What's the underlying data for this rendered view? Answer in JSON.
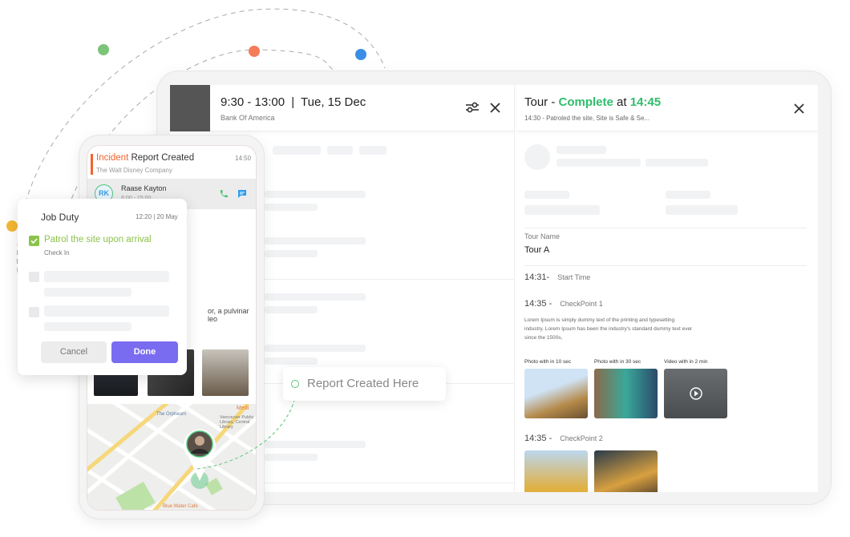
{
  "colors": {
    "accent_green": "#2ebd6b",
    "incident_orange": "#f4622c",
    "done_purple": "#7a6cf0",
    "check_green": "#8bc34a"
  },
  "decor_dots": [
    "#7cc47a",
    "#f47c5a",
    "#3a8ee6",
    "#f5b833"
  ],
  "schedule": {
    "time_range": "9:30 - 13:00",
    "separator": "|",
    "date": "Tue, 15 Dec",
    "location": "Bank Of America",
    "filter_icon": "sliders-icon",
    "close_icon": "close-icon"
  },
  "tour": {
    "title_prefix": "Tour -",
    "status": "Complete",
    "at": "at",
    "time": "14:45",
    "subtitle": "14:30 - Patroled the site, Site is Safe & Se...",
    "name_label": "Tour Name",
    "name": "Tour A",
    "start_time": "14:31-",
    "start_label": "Start Time",
    "cp1_time": "14:35 -",
    "cp1_label": "CheckPoint 1",
    "cp1_desc": "Lorem Ipsum is simply dummy text of the printing and typesetting industry. Lorem Ipsum has been the industry's standard dummy text ever since the 1500s,",
    "media": [
      {
        "label": "Photo with in 10 sec"
      },
      {
        "label": "Photo with in 30 sec"
      },
      {
        "label": "Video with in 2 min"
      }
    ],
    "cp2_time": "14:35 -",
    "cp2_label": "CheckPoint 2"
  },
  "phone": {
    "incident_word": "Incident",
    "title_rest": " Report Created",
    "time": "14:50",
    "company": "The Walt Disney Company",
    "contact": {
      "initials": "RK",
      "name": "Raase Kayton",
      "hours": "8:00 - 15:00"
    },
    "body_text": "or, a pulvinar leo",
    "map_labels": [
      "The Orpheum",
      "Vancouver Public Library, Central Library",
      "Blue Water Cafe",
      "Medi"
    ]
  },
  "job_duty": {
    "title": "Job Duty",
    "timestamp": "12:20 | 20 May",
    "task": "Patrol the site upon arrival",
    "task_sub": "Check In",
    "cancel": "Cancel",
    "done": "Done"
  },
  "callout": {
    "text": "Report Created Here"
  }
}
